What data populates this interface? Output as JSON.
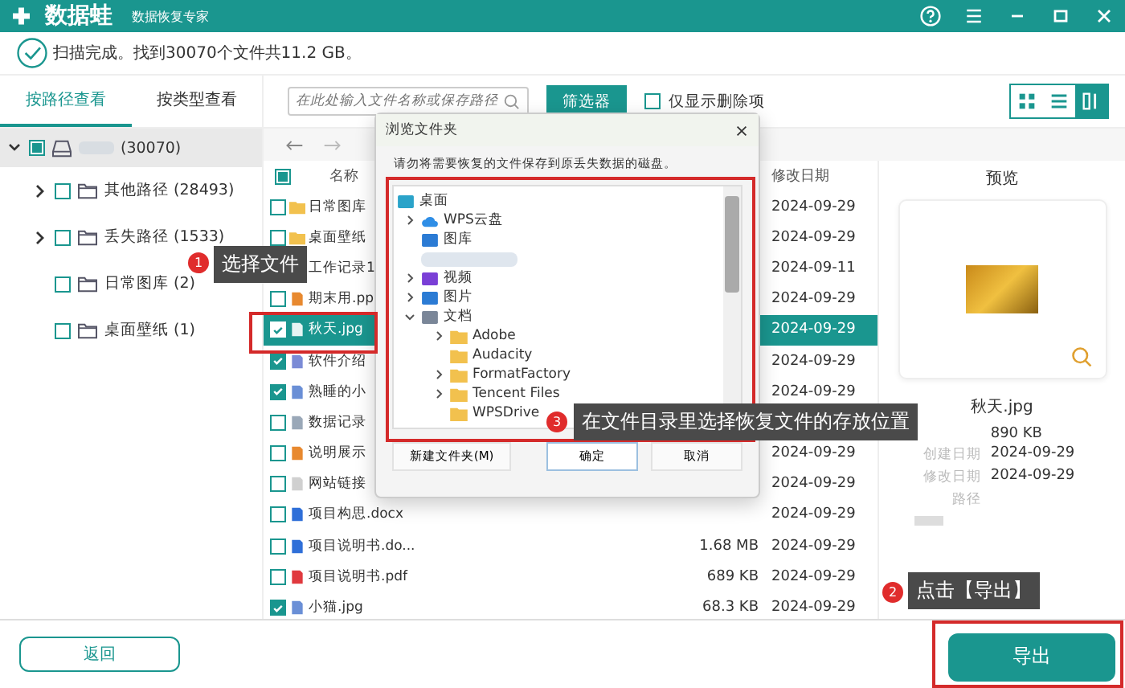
{
  "window": {
    "app_name": "数据蛙",
    "subtitle": "数据恢复专家"
  },
  "status": {
    "message": "扫描完成。找到30070个文件共11.2 GB。"
  },
  "tabs": [
    {
      "label": "按路径查看",
      "selected": true
    },
    {
      "label": "按类型查看",
      "selected": false
    }
  ],
  "search": {
    "placeholder": "在此处输入文件名称或保存路径"
  },
  "filter_button": "筛选器",
  "deleted_only": {
    "label": "仅显示删除项",
    "checked": false
  },
  "view_modes": [
    {
      "kind": "grid",
      "selected": false
    },
    {
      "kind": "list",
      "selected": false
    },
    {
      "kind": "detail",
      "selected": true
    }
  ],
  "tree": {
    "root": {
      "count": "(30070)",
      "expanded": true,
      "checked": true,
      "selected": true
    },
    "items": [
      {
        "label": "其他路径 (28493)",
        "expanded": false,
        "checked": false,
        "selected": false
      },
      {
        "label": "丢失路径 (1533)",
        "expanded": false,
        "checked": false,
        "selected": false
      },
      {
        "label": "日常图库 (2)",
        "checked": false,
        "selected": false
      },
      {
        "label": "桌面壁纸 (1)",
        "checked": false,
        "selected": false
      }
    ]
  },
  "table": {
    "columns": {
      "name": "名称",
      "date": "修改日期"
    },
    "header_checked": true,
    "rows": [
      {
        "name": "日常图库",
        "kind": "folder",
        "date": "2024-09-29",
        "checked": false,
        "selected": false
      },
      {
        "name": "桌面壁纸",
        "kind": "folder",
        "date": "2024-09-29",
        "checked": false,
        "selected": false
      },
      {
        "name": "工作记录1",
        "kind": "doc",
        "date": "2024-09-11",
        "selected": false
      },
      {
        "name": "期末用.pp",
        "kind": "ppt",
        "date": "2024-09-29",
        "checked": false,
        "selected": false
      },
      {
        "name": "秋天.jpg",
        "kind": "image",
        "date": "2024-09-29",
        "checked": true,
        "selected": true
      },
      {
        "name": "软件介绍",
        "kind": "video",
        "date": "2024-09-29",
        "checked": true,
        "selected": false
      },
      {
        "name": "熟睡的小",
        "kind": "image",
        "date": "2024-09-29",
        "checked": true,
        "selected": false
      },
      {
        "name": "数据记录",
        "kind": "sheet",
        "checked": false,
        "selected": false
      },
      {
        "name": "说明展示",
        "kind": "ppt",
        "date": "2024-09-29",
        "checked": false,
        "selected": false
      },
      {
        "name": "网站链接",
        "kind": "text",
        "date": "2024-09-29",
        "checked": false,
        "selected": false
      },
      {
        "name": "项目构思.docx",
        "kind": "word",
        "date": "2024-09-29",
        "checked": false,
        "selected": false
      },
      {
        "name": "项目说明书.do...",
        "kind": "word",
        "size": "1.68 MB",
        "date": "2024-09-29",
        "checked": false,
        "selected": false
      },
      {
        "name": "项目说明书.pdf",
        "kind": "pdf",
        "size": "689 KB",
        "date": "2024-09-29",
        "checked": false,
        "selected": false
      },
      {
        "name": "小猫.jpg",
        "kind": "image",
        "size": "68.3 KB",
        "date": "2024-09-29",
        "checked": true,
        "selected": false
      }
    ]
  },
  "preview": {
    "title": "预览",
    "file_name": "秋天.jpg",
    "size": "890 KB",
    "fields": [
      {
        "label": "创建日期",
        "value": "2024-09-29"
      },
      {
        "label": "修改日期",
        "value": "2024-09-29"
      },
      {
        "label": "路径"
      }
    ]
  },
  "back_button": "返回",
  "export_button": "导出",
  "dialog": {
    "title": "浏览文件夹",
    "message": "请勿将需要恢复的文件保存到原丢失数据的磁盘。",
    "tree": [
      {
        "label": "桌面",
        "kind": "desktop",
        "children": [
          {
            "label": "WPS云盘",
            "kind": "cloud",
            "expanded": false
          },
          {
            "label": "图库",
            "kind": "gallery"
          },
          {
            "kind": "blurred"
          },
          {
            "label": "视频",
            "kind": "video",
            "expanded": false
          },
          {
            "label": "图片",
            "kind": "gallery",
            "expanded": false
          },
          {
            "label": "文档",
            "kind": "document",
            "expanded": true,
            "children": [
              {
                "label": "Adobe",
                "kind": "folder",
                "expanded": false
              },
              {
                "label": "Audacity",
                "kind": "folder"
              },
              {
                "label": "FormatFactory",
                "kind": "folder",
                "expanded": false
              },
              {
                "label": "Tencent Files",
                "kind": "folder",
                "expanded": false
              },
              {
                "label": "WPSDrive",
                "kind": "folder"
              }
            ]
          }
        ]
      }
    ],
    "buttons": [
      {
        "label": "新建文件夹(M)",
        "kind": "secondary"
      },
      {
        "label": "确定",
        "kind": "default"
      },
      {
        "label": "取消",
        "kind": "secondary"
      }
    ]
  },
  "annotations": [
    {
      "badge": "1",
      "text": "选择文件"
    },
    {
      "badge": "2",
      "text": "点击【导出】"
    },
    {
      "badge": "3",
      "text": "在文件目录里选择恢复文件的存放位置"
    }
  ]
}
